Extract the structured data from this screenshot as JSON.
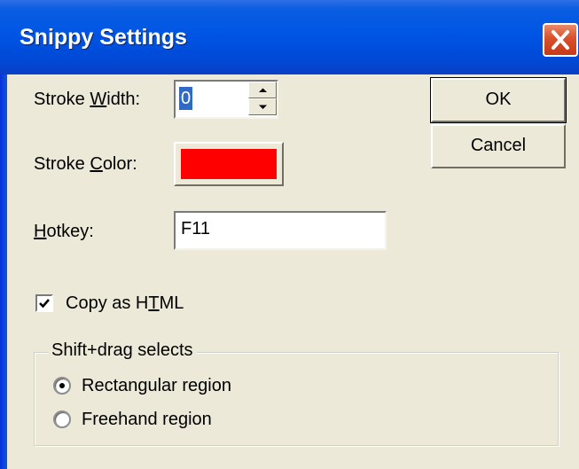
{
  "window": {
    "title": "Snippy Settings"
  },
  "icons": {
    "close": "close-icon",
    "spin_up": "arrow-up-icon",
    "spin_down": "arrow-down-icon",
    "check": "checkmark-icon"
  },
  "fields": {
    "stroke_width": {
      "label_pre": "Stroke ",
      "label_mnemonic": "W",
      "label_post": "idth:",
      "value": "0"
    },
    "stroke_color": {
      "label_pre": "Stroke ",
      "label_mnemonic": "C",
      "label_post": "olor:",
      "color": "#ff0000"
    },
    "hotkey": {
      "label_mnemonic": "H",
      "label_post": "otkey:",
      "value": "F11"
    }
  },
  "buttons": {
    "ok": "OK",
    "cancel": "Cancel"
  },
  "copy_html": {
    "label_pre": "Copy as H",
    "label_mnemonic": "T",
    "label_post": "ML",
    "checked": true
  },
  "shift_drag": {
    "legend": "Shift+drag selects",
    "options": [
      {
        "label": "Rectangular region",
        "selected": true
      },
      {
        "label": "Freehand region",
        "selected": false
      }
    ]
  },
  "colors": {
    "titlebar": "#0055e5",
    "dialog_bg": "#ece9d8",
    "close_button": "#d9502b",
    "selection": "#316ac5"
  }
}
